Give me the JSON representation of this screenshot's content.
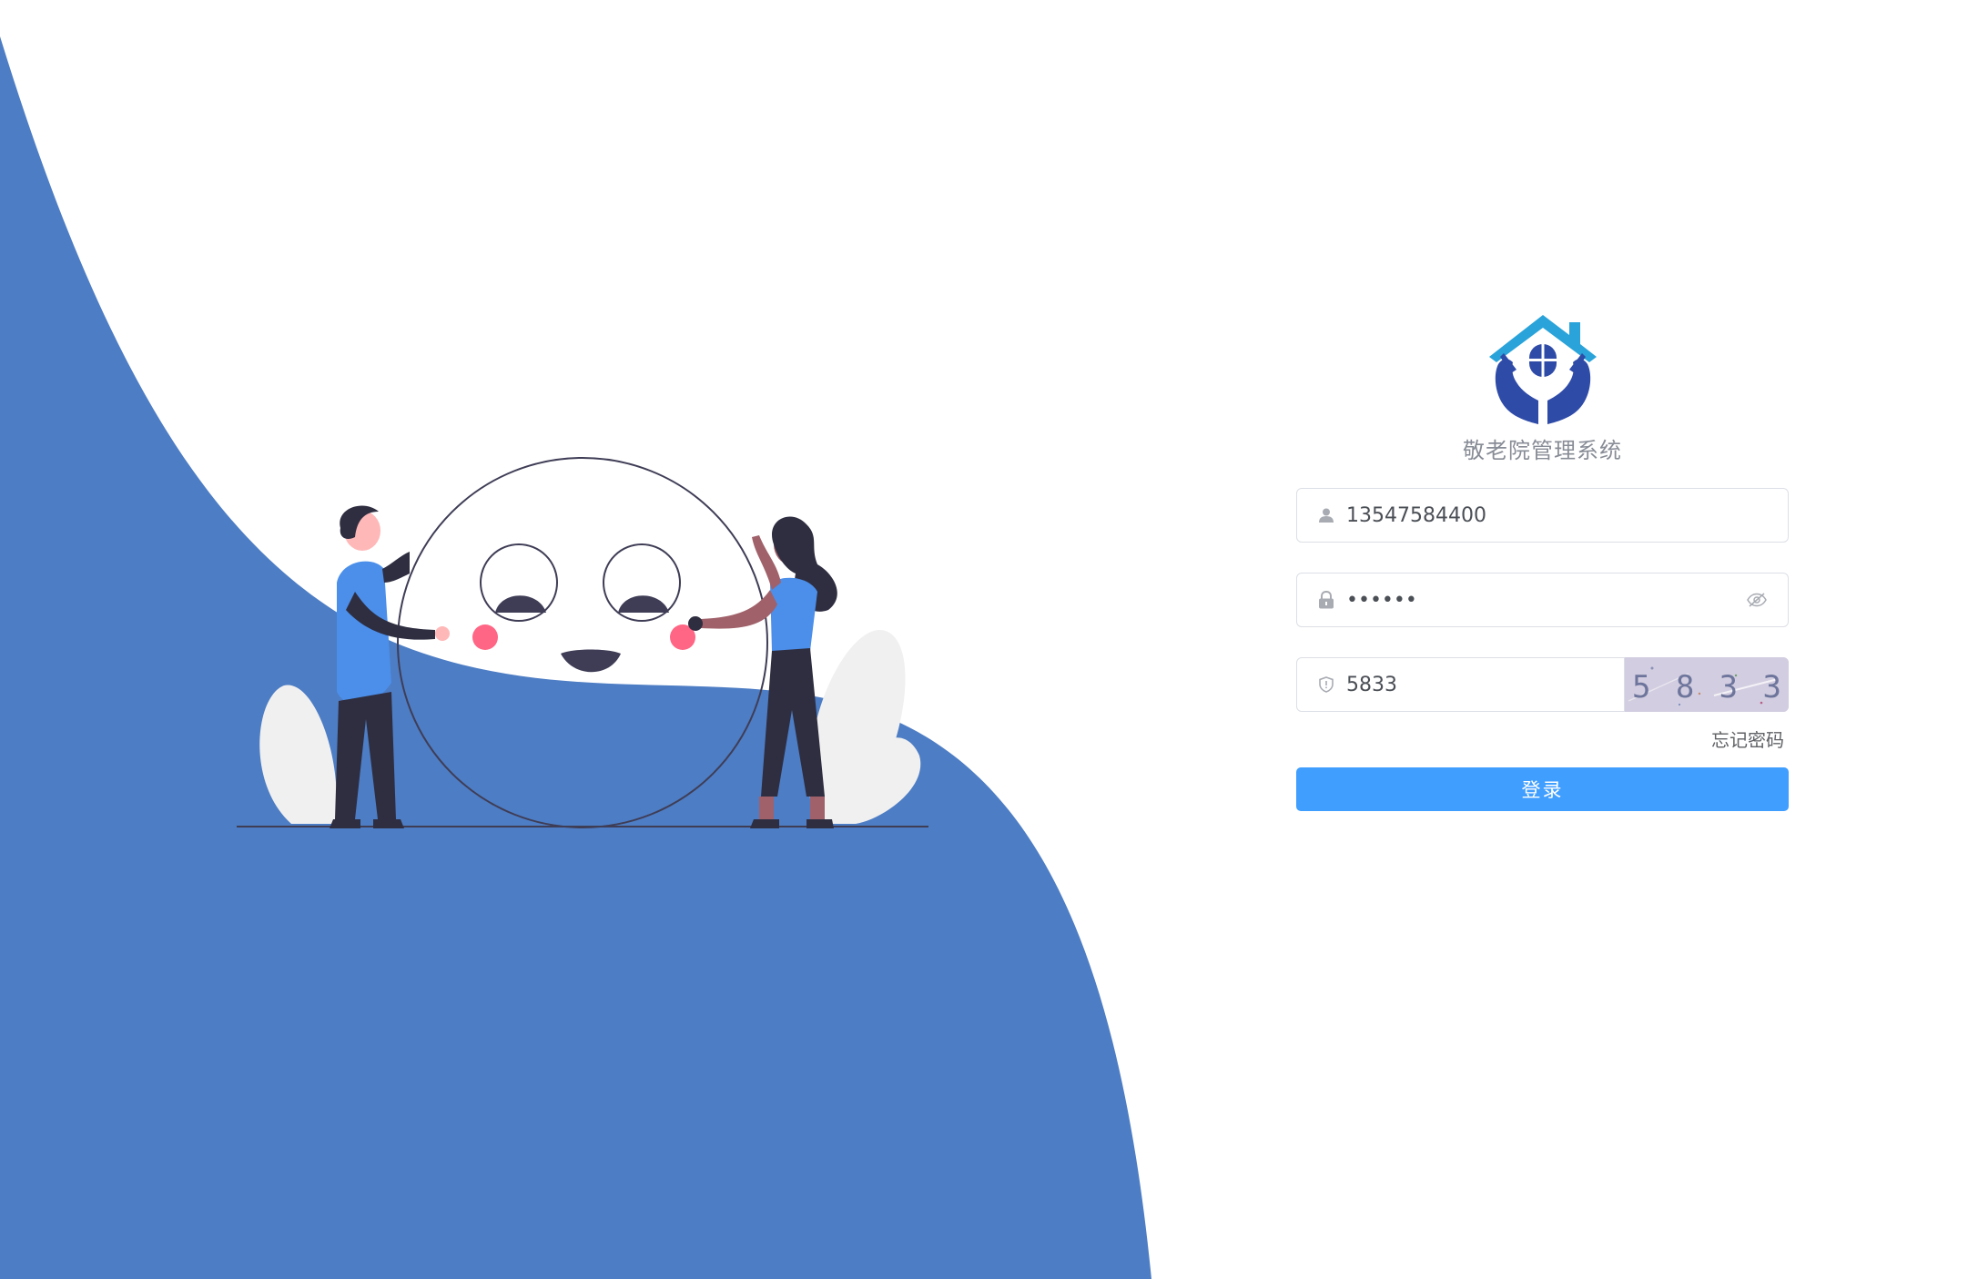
{
  "brand": {
    "title": "敬老院管理系统"
  },
  "form": {
    "username": "13547584400",
    "password": "••••••",
    "captcha_value": "5833",
    "captcha_image_text": "5833",
    "forgot_password_label": "忘记密码",
    "login_button_label": "登录"
  },
  "colors": {
    "accent": "#409eff",
    "background_wave": "#4d7dc4",
    "logo_blue": "#2f4ba8",
    "logo_teal": "#29a3d9",
    "border": "#dcdfe6"
  },
  "icons": {
    "username": "user-icon",
    "password": "lock-icon",
    "password_toggle": "eye-off-icon",
    "captcha": "shield-icon"
  }
}
